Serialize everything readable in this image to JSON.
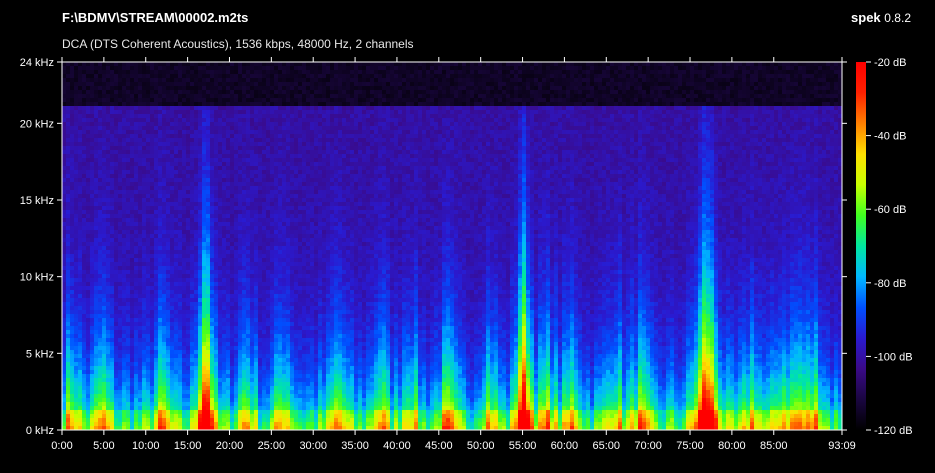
{
  "header": {
    "file_path": "F:\\BDMV\\STREAM\\00002.m2ts",
    "stream_info": "DCA (DTS Coherent Acoustics), 1536 kbps, 48000 Hz, 2 channels",
    "app_name": "spek",
    "app_version": "0.8.2"
  },
  "chart_data": {
    "type": "heatmap",
    "title": "",
    "xlabel": "",
    "ylabel": "",
    "x_ticks": [
      "0:00",
      "5:00",
      "10:00",
      "15:00",
      "20:00",
      "25:00",
      "30:00",
      "35:00",
      "40:00",
      "45:00",
      "50:00",
      "55:00",
      "60:00",
      "65:00",
      "70:00",
      "75:00",
      "80:00",
      "85:00",
      "93:09"
    ],
    "x_tick_minutes": [
      0,
      5,
      10,
      15,
      20,
      25,
      30,
      35,
      40,
      45,
      50,
      55,
      60,
      65,
      70,
      75,
      80,
      85,
      93.15
    ],
    "xlim": [
      0,
      93.15
    ],
    "y_ticks": [
      "0 kHz",
      "5 kHz",
      "10 kHz",
      "15 kHz",
      "20 kHz",
      "24 kHz"
    ],
    "y_tick_khz": [
      0,
      5,
      10,
      15,
      20,
      24
    ],
    "ylim": [
      0,
      24
    ],
    "colorbar_ticks": [
      "-20 dB",
      "-40 dB",
      "-60 dB",
      "-80 dB",
      "-100 dB",
      "-120 dB"
    ],
    "colorbar_tick_db": [
      -20,
      -40,
      -60,
      -80,
      -100,
      -120
    ],
    "colorbar_range": [
      -120,
      -20
    ],
    "colormap": [
      "#000000",
      "#1a0640",
      "#3a0a88",
      "#2a1ad0",
      "#0050ff",
      "#00b8ff",
      "#00e8a0",
      "#40ff20",
      "#c8ff00",
      "#ffe000",
      "#ff8000",
      "#ff2000",
      "#ff0000"
    ],
    "cutoff_khz": 21,
    "band_peaks_min": [
      1.2,
      4.8,
      12,
      17,
      22,
      26.5,
      33,
      38,
      41.5,
      46,
      51,
      55.5,
      58,
      61,
      66,
      69,
      76,
      78,
      82.5,
      86,
      88,
      90
    ],
    "strong_peaks_min": [
      17.2,
      55.0,
      77.0
    ]
  }
}
